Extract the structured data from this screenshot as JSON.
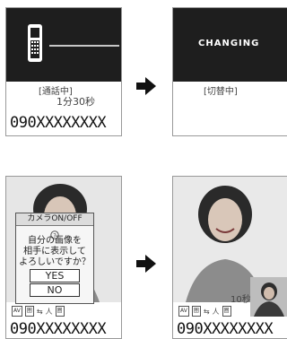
{
  "panels": [
    {
      "status": "[通話中]",
      "timer": "1分30秒",
      "number": "090XXXXXXXX"
    },
    {
      "title": "CHANGING",
      "status": "[切替中]"
    },
    {
      "dialog": {
        "title": "カメラON/OFF",
        "lines": [
          "自分の画像を",
          "相手に表示して",
          "よろしいですか？"
        ],
        "yes": "YES",
        "no": "NO"
      },
      "icons": [
        "AV",
        "圏",
        "⇆",
        "人",
        "圏"
      ],
      "number": "090XXXXXXXX"
    },
    {
      "timer": "10秒",
      "icons": [
        "AV",
        "圏",
        "⇆",
        "人",
        "圏"
      ],
      "number": "090XXXXXXXX"
    }
  ]
}
